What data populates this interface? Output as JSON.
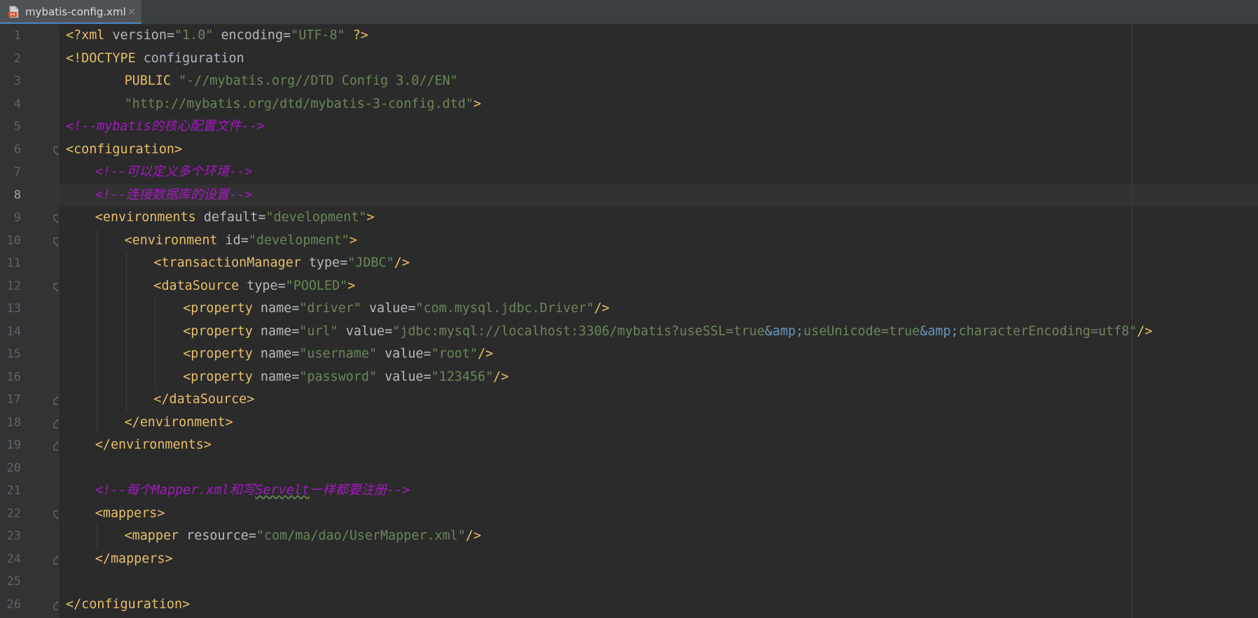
{
  "tab": {
    "title": "mybatis-config.xml",
    "close_glyph": "×",
    "icon": "xml-file-icon"
  },
  "editor": {
    "active_line": 8,
    "line_numbers": [
      "1",
      "2",
      "3",
      "4",
      "5",
      "6",
      "7",
      "8",
      "9",
      "10",
      "11",
      "12",
      "13",
      "14",
      "15",
      "16",
      "17",
      "18",
      "19",
      "20",
      "21",
      "22",
      "23",
      "24",
      "25",
      "26"
    ],
    "lines": [
      {
        "indent": 0,
        "tokens": [
          {
            "t": "tag",
            "v": "<?xml "
          },
          {
            "t": "attr",
            "v": "version"
          },
          {
            "t": "txt",
            "v": "="
          },
          {
            "t": "val",
            "v": "\"1.0\""
          },
          {
            "t": "txt",
            "v": " "
          },
          {
            "t": "attr",
            "v": "encoding"
          },
          {
            "t": "txt",
            "v": "="
          },
          {
            "t": "val",
            "v": "\"UTF-8\""
          },
          {
            "t": "txt",
            "v": " "
          },
          {
            "t": "tag",
            "v": "?>"
          }
        ]
      },
      {
        "indent": 0,
        "tokens": [
          {
            "t": "tag",
            "v": "<!DOCTYPE "
          },
          {
            "t": "txt",
            "v": "configuration"
          }
        ]
      },
      {
        "indent": 8,
        "tokens": [
          {
            "t": "tag",
            "v": "PUBLIC "
          },
          {
            "t": "val",
            "v": "\"-//mybatis.org//DTD Config 3.0//EN\""
          }
        ]
      },
      {
        "indent": 8,
        "tokens": [
          {
            "t": "val",
            "v": "\"http://mybatis.org/dtd/mybatis-3-config.dtd\""
          },
          {
            "t": "tag",
            "v": ">"
          }
        ]
      },
      {
        "indent": 0,
        "tokens": [
          {
            "t": "com",
            "v": "<!--mybatis的核心配置文件-->"
          }
        ]
      },
      {
        "indent": 0,
        "tokens": [
          {
            "t": "tag",
            "v": "<configuration>"
          }
        ]
      },
      {
        "indent": 4,
        "tokens": [
          {
            "t": "com",
            "v": "<!--可以定义多个环境-->"
          }
        ]
      },
      {
        "indent": 4,
        "tokens": [
          {
            "t": "com",
            "v": "<!--连接数据库的设置-->"
          }
        ]
      },
      {
        "indent": 4,
        "tokens": [
          {
            "t": "tag",
            "v": "<environments "
          },
          {
            "t": "attr",
            "v": "default"
          },
          {
            "t": "txt",
            "v": "="
          },
          {
            "t": "val",
            "v": "\"development\""
          },
          {
            "t": "tag",
            "v": ">"
          }
        ]
      },
      {
        "indent": 8,
        "tokens": [
          {
            "t": "tag",
            "v": "<environment "
          },
          {
            "t": "attr",
            "v": "id"
          },
          {
            "t": "txt",
            "v": "="
          },
          {
            "t": "val",
            "v": "\"development\""
          },
          {
            "t": "tag",
            "v": ">"
          }
        ]
      },
      {
        "indent": 12,
        "tokens": [
          {
            "t": "tag",
            "v": "<transactionManager "
          },
          {
            "t": "attr",
            "v": "type"
          },
          {
            "t": "txt",
            "v": "="
          },
          {
            "t": "val",
            "v": "\"JDBC\""
          },
          {
            "t": "tag",
            "v": "/>"
          }
        ]
      },
      {
        "indent": 12,
        "tokens": [
          {
            "t": "tag",
            "v": "<dataSource "
          },
          {
            "t": "attr",
            "v": "type"
          },
          {
            "t": "txt",
            "v": "="
          },
          {
            "t": "val",
            "v": "\"POOLED\""
          },
          {
            "t": "tag",
            "v": ">"
          }
        ]
      },
      {
        "indent": 16,
        "tokens": [
          {
            "t": "tag",
            "v": "<property "
          },
          {
            "t": "attr",
            "v": "name"
          },
          {
            "t": "txt",
            "v": "="
          },
          {
            "t": "val",
            "v": "\"driver\""
          },
          {
            "t": "txt",
            "v": " "
          },
          {
            "t": "attr",
            "v": "value"
          },
          {
            "t": "txt",
            "v": "="
          },
          {
            "t": "val",
            "v": "\"com.mysql.jdbc.Driver\""
          },
          {
            "t": "tag",
            "v": "/>"
          }
        ]
      },
      {
        "indent": 16,
        "tokens": [
          {
            "t": "tag",
            "v": "<property "
          },
          {
            "t": "attr",
            "v": "name"
          },
          {
            "t": "txt",
            "v": "="
          },
          {
            "t": "val",
            "v": "\"url\""
          },
          {
            "t": "txt",
            "v": " "
          },
          {
            "t": "attr",
            "v": "value"
          },
          {
            "t": "txt",
            "v": "="
          },
          {
            "t": "val",
            "v": "\"jdbc:mysql://localhost:3306/mybatis?useSSL=true"
          },
          {
            "t": "ent",
            "v": "&amp;"
          },
          {
            "t": "val",
            "v": "useUnicode=true"
          },
          {
            "t": "ent",
            "v": "&amp;"
          },
          {
            "t": "val",
            "v": "characterEncoding=utf8\""
          },
          {
            "t": "tag",
            "v": "/>"
          }
        ]
      },
      {
        "indent": 16,
        "tokens": [
          {
            "t": "tag",
            "v": "<property "
          },
          {
            "t": "attr",
            "v": "name"
          },
          {
            "t": "txt",
            "v": "="
          },
          {
            "t": "val",
            "v": "\"username\""
          },
          {
            "t": "txt",
            "v": " "
          },
          {
            "t": "attr",
            "v": "value"
          },
          {
            "t": "txt",
            "v": "="
          },
          {
            "t": "val",
            "v": "\"root\""
          },
          {
            "t": "tag",
            "v": "/>"
          }
        ]
      },
      {
        "indent": 16,
        "tokens": [
          {
            "t": "tag",
            "v": "<property "
          },
          {
            "t": "attr",
            "v": "name"
          },
          {
            "t": "txt",
            "v": "="
          },
          {
            "t": "val",
            "v": "\"password\""
          },
          {
            "t": "txt",
            "v": " "
          },
          {
            "t": "attr",
            "v": "value"
          },
          {
            "t": "txt",
            "v": "="
          },
          {
            "t": "val",
            "v": "\"123456\""
          },
          {
            "t": "tag",
            "v": "/>"
          }
        ]
      },
      {
        "indent": 12,
        "tokens": [
          {
            "t": "tag",
            "v": "</dataSource>"
          }
        ]
      },
      {
        "indent": 8,
        "tokens": [
          {
            "t": "tag",
            "v": "</environment>"
          }
        ]
      },
      {
        "indent": 4,
        "tokens": [
          {
            "t": "tag",
            "v": "</environments>"
          }
        ]
      },
      {
        "indent": 0,
        "tokens": []
      },
      {
        "indent": 4,
        "tokens": [
          {
            "t": "com",
            "v": "<!--每个Mapper.xml和写"
          },
          {
            "t": "com-typo",
            "v": "Servelt"
          },
          {
            "t": "com",
            "v": "一样都要注册-->"
          }
        ]
      },
      {
        "indent": 4,
        "tokens": [
          {
            "t": "tag",
            "v": "<mappers>"
          }
        ]
      },
      {
        "indent": 8,
        "tokens": [
          {
            "t": "tag",
            "v": "<mapper "
          },
          {
            "t": "attr",
            "v": "resource"
          },
          {
            "t": "txt",
            "v": "="
          },
          {
            "t": "val",
            "v": "\"com/ma/dao/UserMapper.xml\""
          },
          {
            "t": "tag",
            "v": "/>"
          }
        ]
      },
      {
        "indent": 4,
        "tokens": [
          {
            "t": "tag",
            "v": "</mappers>"
          }
        ]
      },
      {
        "indent": 0,
        "tokens": []
      },
      {
        "indent": 0,
        "tokens": [
          {
            "t": "tag",
            "v": "</configuration>"
          }
        ]
      }
    ],
    "folds": [
      {
        "line": 6,
        "kind": "open"
      },
      {
        "line": 9,
        "kind": "open"
      },
      {
        "line": 10,
        "kind": "open"
      },
      {
        "line": 12,
        "kind": "open"
      },
      {
        "line": 17,
        "kind": "close"
      },
      {
        "line": 18,
        "kind": "close"
      },
      {
        "line": 19,
        "kind": "close"
      },
      {
        "line": 22,
        "kind": "open"
      },
      {
        "line": 24,
        "kind": "close"
      },
      {
        "line": 26,
        "kind": "close"
      }
    ]
  },
  "colors": {
    "background": "#2b2b2b",
    "gutter": "#313335",
    "tag": "#e8bf6a",
    "attribute": "#bababa",
    "value": "#6a8759",
    "comment": "#a418c2",
    "entity": "#6897bb"
  }
}
